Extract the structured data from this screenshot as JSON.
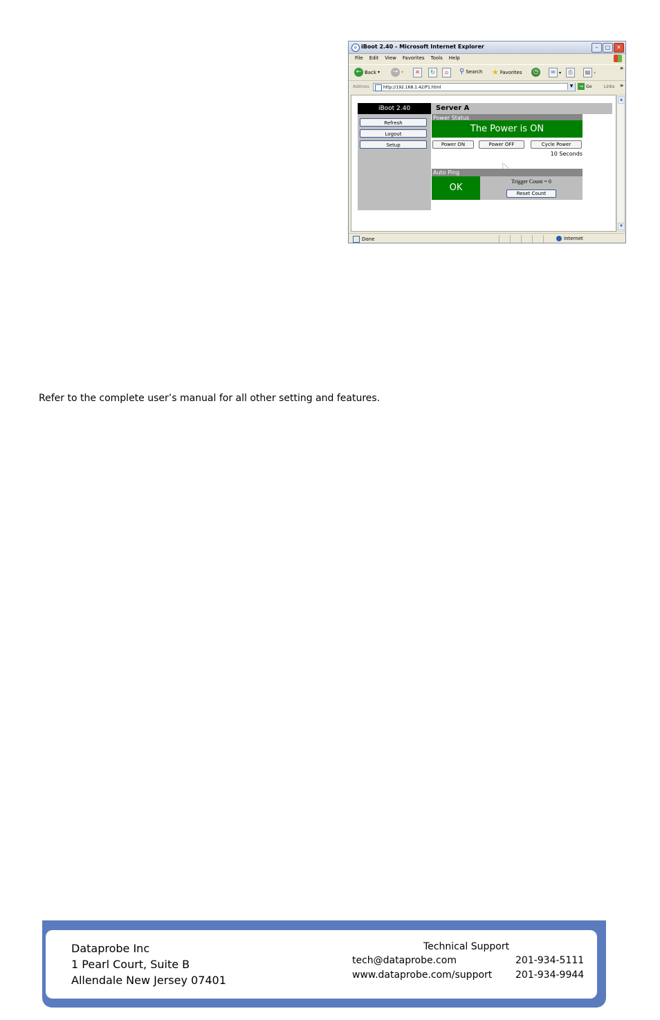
{
  "browser": {
    "window_title": "iBoot 2.40 - Microsoft Internet Explorer",
    "menu": [
      "File",
      "Edit",
      "View",
      "Favorites",
      "Tools",
      "Help"
    ],
    "toolbar": {
      "back": "Back",
      "search": "Search",
      "favorites": "Favorites"
    },
    "address_label": "Address",
    "address_url": "http://192.168.1.42/P1.html",
    "go_label": "Go",
    "links_label": "Links",
    "status_text": "Done",
    "zone_text": "Internet"
  },
  "iboot": {
    "header_title": "iBoot 2.40",
    "server_name": "Server A",
    "sidebar_buttons": [
      "Refresh",
      "Logout",
      "Setup"
    ],
    "power_status_label": "Power Status",
    "power_state_text": "The Power is ON",
    "power_buttons": [
      "Power ON",
      "Power OFF",
      "Cycle Power"
    ],
    "cycle_time": "10 Seconds",
    "auto_ping_label": "Auto Ping",
    "ping_state": "OK",
    "trigger_count_text": "Trigger Count = 0",
    "reset_button": "Reset Count",
    "colors": {
      "status_green": "#008000",
      "panel_gray": "#bdbdbd",
      "bar_gray": "#878787"
    }
  },
  "document": {
    "note": "Refer to the complete user’s manual for all other setting and features."
  },
  "footer": {
    "company_lines": [
      "Dataprobe Inc",
      "1 Pearl Court, Suite B",
      "Allendale New Jersey 07401"
    ],
    "support_title": "Technical Support",
    "support_email": "tech@dataprobe.com",
    "support_url": "www.dataprobe.com/support",
    "phone_1": "201-934-5111",
    "phone_2": "201-934-9944",
    "frame_color": "#5a7cbf"
  }
}
